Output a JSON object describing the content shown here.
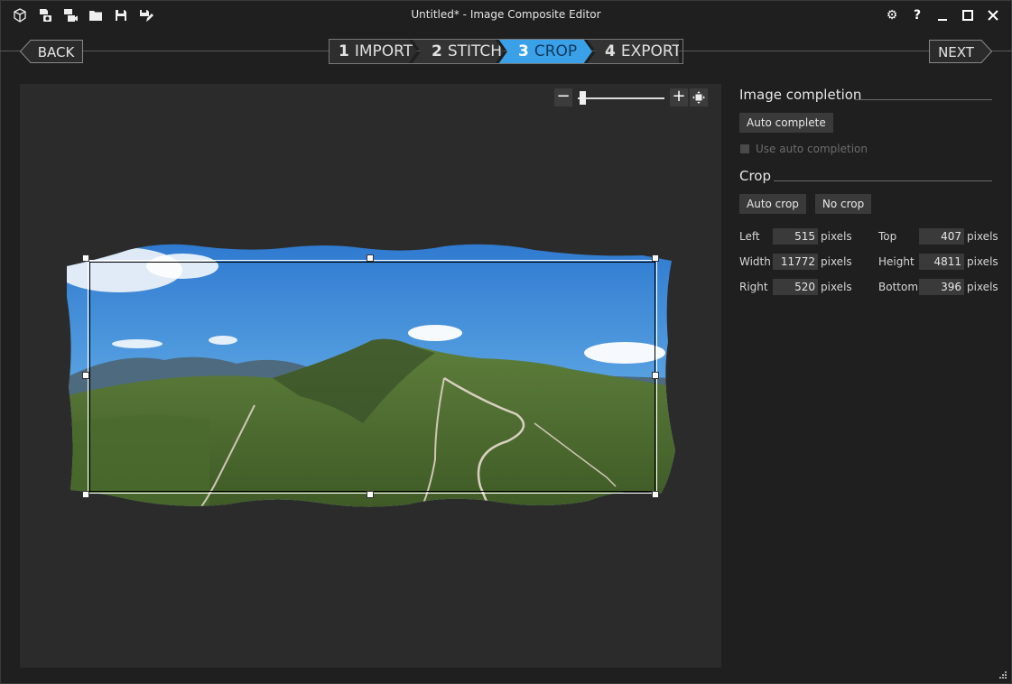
{
  "window": {
    "title": "Untitled* - Image Composite Editor",
    "toolbar_icons": [
      "new-panorama-icon",
      "new-from-images-icon",
      "new-from-video-icon",
      "open-icon",
      "save-icon",
      "save-as-icon"
    ],
    "controls": {
      "settings": "⚙",
      "help": "?",
      "minimize": "—",
      "maximize": "☐",
      "close": "✕"
    }
  },
  "nav": {
    "back_label": "BACK",
    "next_label": "NEXT",
    "steps": [
      {
        "num": "1",
        "label": "IMPORT"
      },
      {
        "num": "2",
        "label": "STITCH"
      },
      {
        "num": "3",
        "label": "CROP"
      },
      {
        "num": "4",
        "label": "EXPORT"
      }
    ],
    "active_step": 3,
    "active_color": "#3aa0e8"
  },
  "zoom": {
    "minus": "−",
    "plus": "+",
    "level": 0.05
  },
  "image_completion": {
    "title": "Image completion",
    "auto_complete_label": "Auto complete",
    "use_auto_completion_label": "Use auto completion",
    "use_auto_completion_checked": false,
    "use_auto_completion_enabled": false
  },
  "crop": {
    "title": "Crop",
    "auto_crop_label": "Auto crop",
    "no_crop_label": "No crop",
    "unit": "pixels",
    "left": {
      "label": "Left",
      "value": "515"
    },
    "top": {
      "label": "Top",
      "value": "407"
    },
    "width": {
      "label": "Width",
      "value": "11772"
    },
    "height": {
      "label": "Height",
      "value": "4811"
    },
    "right": {
      "label": "Right",
      "value": "520"
    },
    "bottom": {
      "label": "Bottom",
      "value": "396"
    }
  }
}
